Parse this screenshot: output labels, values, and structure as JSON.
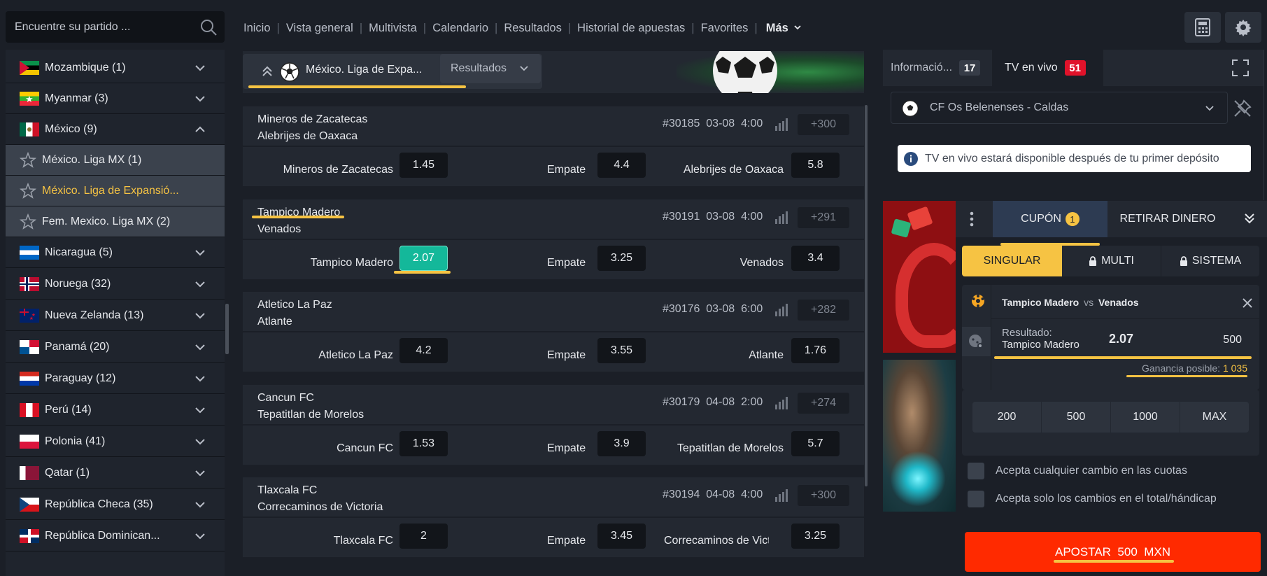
{
  "header": {
    "search_placeholder": "Encuentre su partido ...",
    "nav": [
      "Inicio",
      "Vista general",
      "Multivista",
      "Calendario",
      "Resultados",
      "Historial de apuestas",
      "Favorites"
    ],
    "more_label": "Más"
  },
  "sidebar": {
    "items": [
      {
        "label": "Mozambique (1)"
      },
      {
        "label": "Myanmar (3)"
      },
      {
        "label": "México (9)"
      },
      {
        "label": "México. Liga MX (1)"
      },
      {
        "label": "México. Liga de Expansió..."
      },
      {
        "label": "Fem. Mexico. Liga MX (2)"
      },
      {
        "label": "Nicaragua (5)"
      },
      {
        "label": "Noruega (32)"
      },
      {
        "label": "Nueva Zelanda (13)"
      },
      {
        "label": "Panamá (20)"
      },
      {
        "label": "Paraguay (12)"
      },
      {
        "label": "Perú (14)"
      },
      {
        "label": "Polonia (41)"
      },
      {
        "label": "Qatar (1)"
      },
      {
        "label": "República Checa (35)"
      },
      {
        "label": "República Dominican..."
      }
    ]
  },
  "league": {
    "name": "México. Liga de Expa...",
    "filter": "Resultados"
  },
  "matches": [
    {
      "home": "Mineros de Zacatecas",
      "away": "Alebrijes de Oaxaca",
      "id": "#30185",
      "date": "03-08",
      "time": "4:00",
      "more": "+300",
      "draw_label": "Empate",
      "odds": [
        "1.45",
        "4.4",
        "5.8"
      ],
      "away_label": "Alebrijes de Oaxaca"
    },
    {
      "home": "Tampico Madero",
      "away": "Venados",
      "id": "#30191",
      "date": "03-08",
      "time": "4:00",
      "more": "+291",
      "draw_label": "Empate",
      "odds": [
        "2.07",
        "3.25",
        "3.4"
      ],
      "away_label": "Venados"
    },
    {
      "home": "Atletico La Paz",
      "away": "Atlante",
      "id": "#30176",
      "date": "03-08",
      "time": "6:00",
      "more": "+282",
      "draw_label": "Empate",
      "odds": [
        "4.2",
        "3.55",
        "1.76"
      ],
      "away_label": "Atlante"
    },
    {
      "home": "Cancun FC",
      "away": "Tepatitlan de Morelos",
      "id": "#30179",
      "date": "04-08",
      "time": "2:00",
      "more": "+274",
      "draw_label": "Empate",
      "odds": [
        "1.53",
        "3.9",
        "5.7"
      ],
      "away_label": "Tepatitlan de Morelos"
    },
    {
      "home": "Tlaxcala FC",
      "away": "Correcaminos de Victoria",
      "id": "#30194",
      "date": "04-08",
      "time": "4:00",
      "more": "+300",
      "draw_label": "Empate",
      "odds": [
        "2",
        "3.45",
        "3.25"
      ],
      "away_label": "Correcaminos de Vict..."
    }
  ],
  "right_top": {
    "info_tab": "Informació...",
    "info_count": "17",
    "tv_tab": "TV en vivo",
    "tv_count": "51",
    "tv_match": "CF Os Belenenses - Caldas",
    "tv_notice": "TV en vivo estará disponible después de tu primer depósito"
  },
  "coupon": {
    "tab_coupon": "CUPÓN",
    "coupon_count": "1",
    "tab_withdraw": "RETIRAR DINERO",
    "bet_types": [
      "SINGULAR",
      "MULTI",
      "SISTEMA"
    ],
    "bet_home": "Tampico Madero",
    "vs": "vs",
    "bet_away": "Venados",
    "result_label": "Resultado:",
    "result_value": "Tampico Madero",
    "odd": "2.07",
    "stake": "500",
    "gain_label": "Ganancia posible:",
    "gain_value": "1 035",
    "quick_amounts": [
      "200",
      "500",
      "1000",
      "MAX"
    ],
    "accept_any": "Acepta cualquier cambio en las cuotas",
    "accept_total": "Acepta solo los cambios en el total/hándicap",
    "place_label": "APOSTAR  500  MXN"
  },
  "colors": {
    "accent": "#f6c343",
    "selected_odd": "#14b89a",
    "place_bet": "#ff2a00",
    "badge_red": "#e0122a"
  }
}
